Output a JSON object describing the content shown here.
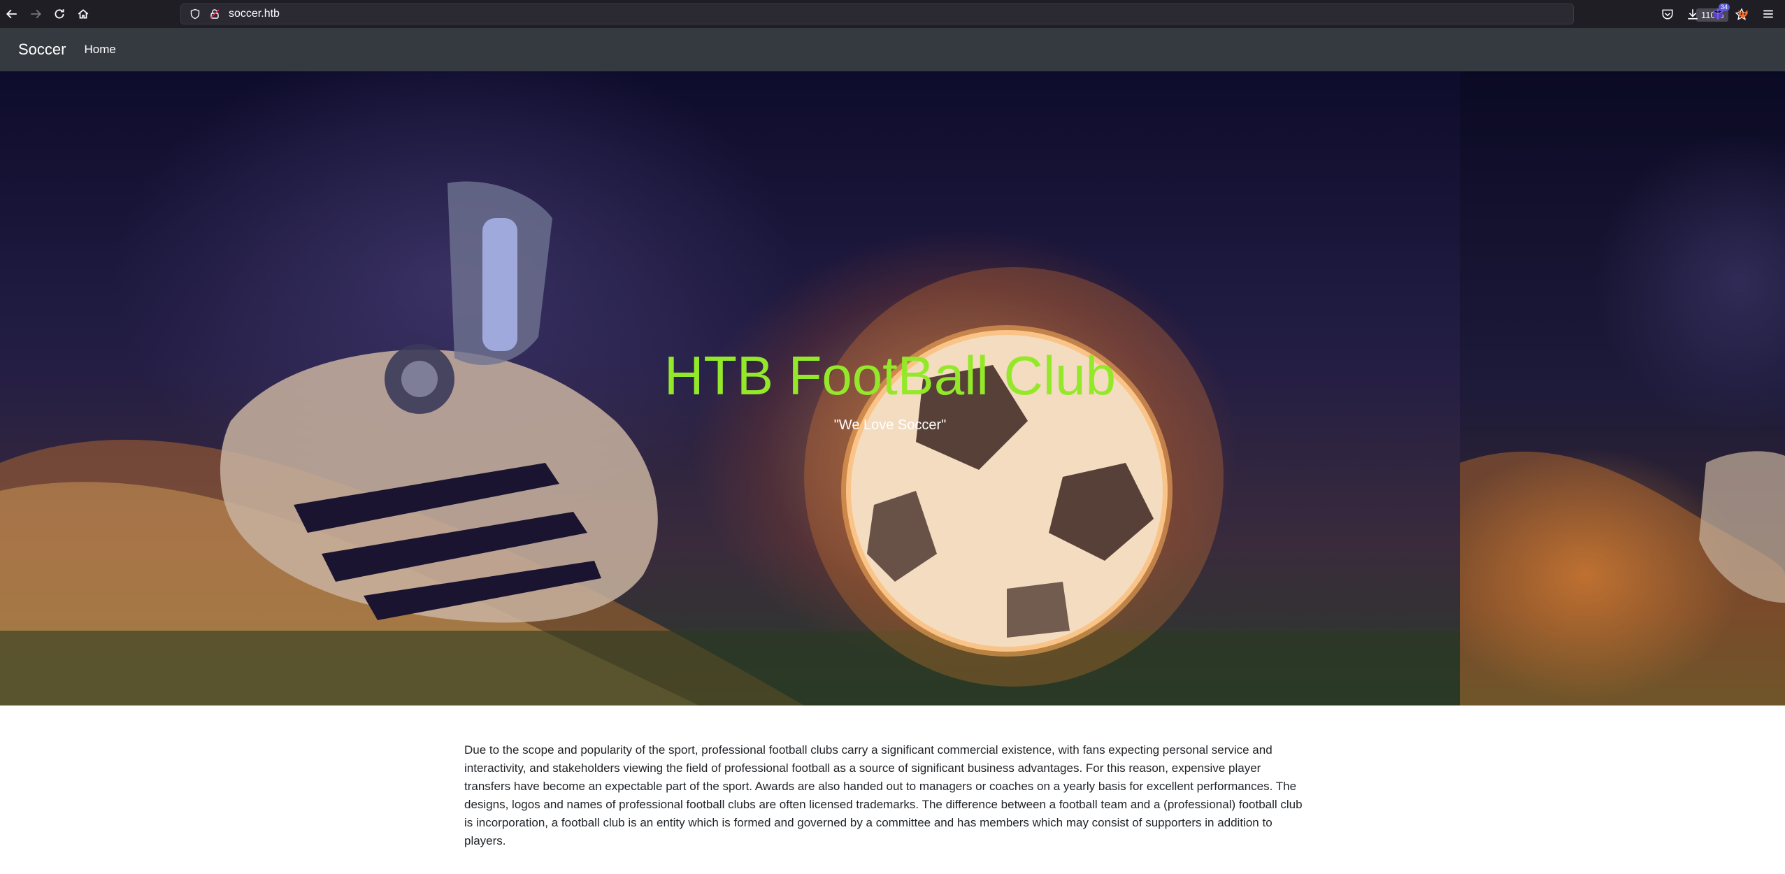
{
  "browser": {
    "url": "soccer.htb",
    "zoom": "110%",
    "extension_badge": "34"
  },
  "site": {
    "brand": "Soccer",
    "nav": [
      {
        "label": "Home"
      }
    ]
  },
  "hero": {
    "title": "HTB FootBall Club",
    "subtitle": "\"We Love Soccer\""
  },
  "content": {
    "paragraph": "Due to the scope and popularity of the sport, professional football clubs carry a significant commercial existence, with fans expecting personal service and interactivity, and stakeholders viewing the field of professional football as a source of significant business advantages. For this reason, expensive player transfers have become an expectable part of the sport. Awards are also handed out to managers or coaches on a yearly basis for excellent performances. The designs, logos and names of professional football clubs are often licensed trademarks. The difference between a football team and a (professional) football club is incorporation, a football club is an entity which is formed and governed by a committee and has members which may consist of supporters in addition to players."
  },
  "colors": {
    "hero_title": "#94e82a",
    "navbar_bg": "#343a40",
    "chrome_bg": "#1f1e25"
  }
}
